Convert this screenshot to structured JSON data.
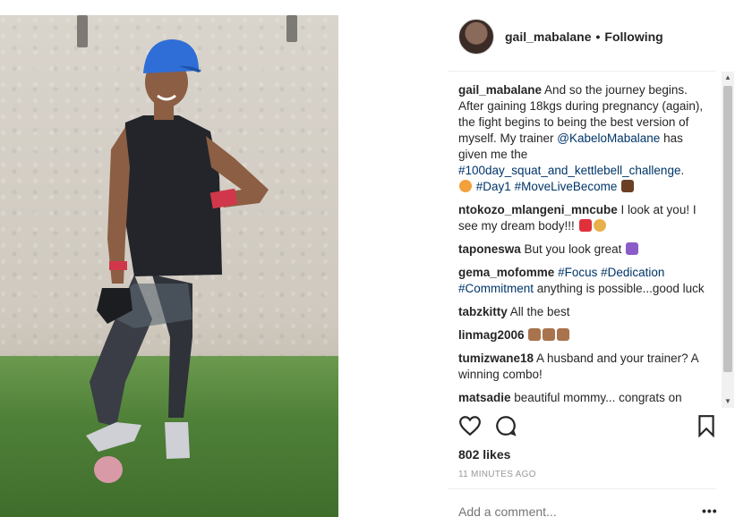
{
  "post": {
    "username": "gail_mabalane",
    "separator": "•",
    "follow_status": "Following"
  },
  "caption": {
    "user": "gail_mabalane",
    "text": " And so the journey begins. After gaining 18kgs during pregnancy (again), the fight begins to being the best version of myself. My trainer ",
    "mention": "@KabeloMabalane",
    "text2": " has given me the ",
    "hashtag1": "#100day_squat_and_kettlebell_challenge",
    "text3": ".",
    "hashtag2": "#Day1",
    "hashtag3": "#MoveLiveBecome"
  },
  "comments": [
    {
      "user": "ntokozo_mlangeni_mncube",
      "text": " I look at you! I see my dream body!!! "
    },
    {
      "user": "taponeswa",
      "text": " But you look great "
    },
    {
      "user": "gema_mofomme",
      "tag1": "#Focus",
      "tag2": "#Dedication",
      "tag3": "#Commitment",
      "text": " anything is possible...good luck"
    },
    {
      "user": "tabzkitty",
      "text": " All the best"
    },
    {
      "user": "linmag2006",
      "text": " "
    },
    {
      "user": "tumizwane18",
      "text": " A husband and your trainer? A winning combo!"
    },
    {
      "user": "matsadie",
      "text": " beautiful mommy... congrats on"
    }
  ],
  "likes": "802 likes",
  "timestamp": "11 MINUTES AGO",
  "add_comment_placeholder": "Add a comment...",
  "more_label": "•••",
  "colors": {
    "hashtag": "#003569",
    "text": "#262626",
    "muted": "#999999"
  }
}
